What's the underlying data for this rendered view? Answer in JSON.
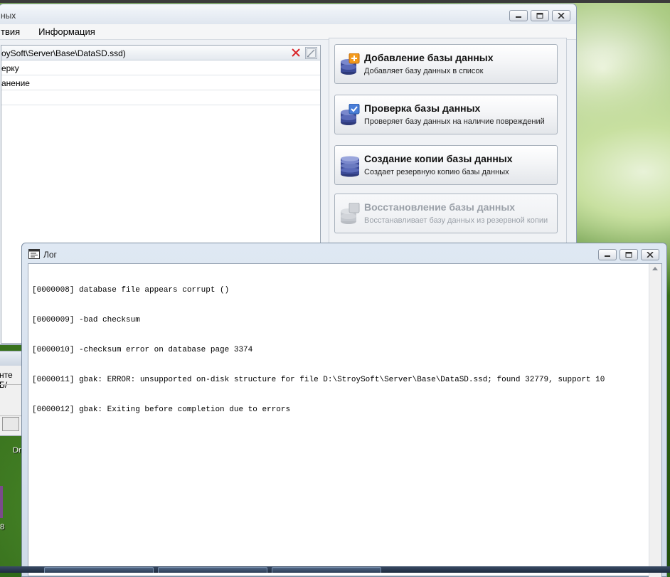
{
  "main_window": {
    "title": "ных",
    "menu": [
      "твия",
      "Информация"
    ],
    "db_path": "oySoft\\Server\\Base\\DataSD.ssd)",
    "rows": [
      "ерку",
      "анение",
      ""
    ]
  },
  "actions": [
    {
      "title": "Добавление базы данных",
      "description": "Добавляет базу данных в список",
      "icon": "database-add-icon",
      "enabled": true
    },
    {
      "title": "Проверка базы данных",
      "description": "Проверяет базу данных на наличие повреждений",
      "icon": "database-check-icon",
      "enabled": true
    },
    {
      "title": "Создание копии базы данных",
      "description": "Создает резервную копию базы данных",
      "icon": "database-backup-icon",
      "enabled": true
    },
    {
      "title": "Восстановление базы данных",
      "description": "Восстанавливает базу данных из резервной копии",
      "icon": "database-restore-icon",
      "enabled": false
    }
  ],
  "sub_window": {
    "text": "нте Б/"
  },
  "desktop": {
    "icon_label": "Dr",
    "icon_number": "8"
  },
  "log_window": {
    "title": "Лог",
    "lines": [
      "[0000008] database file appears corrupt ()",
      "[0000009] -bad checksum",
      "[0000010] -checksum error on database page 3374",
      "[0000011] gbak: ERROR: unsupported on-disk structure for file D:\\StroySoft\\Server\\Base\\DataSD.ssd; found 32779, support 10",
      "[0000012] gbak: Exiting before completion due to errors"
    ]
  },
  "colors": {
    "titlebar": "#dfe6ef",
    "disabled_text": "#9aa0a8",
    "clear_icon": "#d9262b"
  }
}
